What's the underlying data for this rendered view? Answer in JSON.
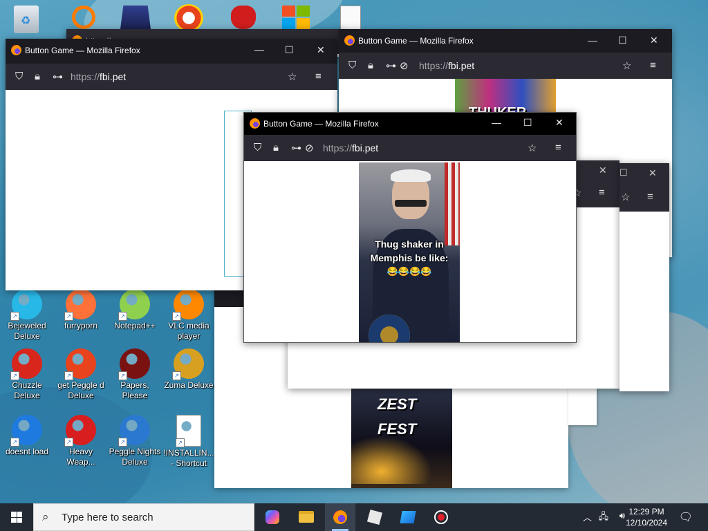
{
  "desktop": {
    "icons": [
      {
        "label": "Bejeweled Deluxe",
        "icon": "bejeweled-icon",
        "color": "#28b8e8"
      },
      {
        "label": "furryporn",
        "icon": "firefox-icon",
        "color": "#ff7139"
      },
      {
        "label": "Notepad++",
        "icon": "notepadpp-icon",
        "color": "#8fd14f"
      },
      {
        "label": "VLC media player",
        "icon": "vlc-icon",
        "color": "#ff8800"
      },
      {
        "label": "Chuzzle Deluxe",
        "icon": "chuzzle-icon",
        "color": "#d9261c"
      },
      {
        "label": "get Peggle d Deluxe",
        "icon": "peggle-icon",
        "color": "#e8431d"
      },
      {
        "label": "Papers, Please",
        "icon": "papers-please-icon",
        "color": "#7a1212"
      },
      {
        "label": "Zuma Deluxe",
        "icon": "zuma-icon",
        "color": "#d8a020"
      },
      {
        "label": "doesnt load",
        "icon": "thunderbird-icon",
        "color": "#1f7ae0"
      },
      {
        "label": "Heavy Weap...",
        "icon": "radiation-icon",
        "color": "#d81e1e"
      },
      {
        "label": "Peggle Nights Deluxe",
        "icon": "peggle-nights-icon",
        "color": "#2a78d0"
      },
      {
        "label": "!INSTALLIN... - Shortcut",
        "icon": "text-file-icon",
        "color": "#ffffff"
      }
    ],
    "top_icons": [
      "recycle-bin-icon",
      "search-app-icon",
      "malwarebytes-icon",
      "peggle-icon",
      "angry-birds-icon",
      "windows-logo-icon",
      "text-file-icon"
    ]
  },
  "browser": {
    "title": "Button Game — Mozilla Firefox",
    "url_scheme": "https://",
    "url_host": "fbi.pet",
    "back_tab_url": "https://www"
  },
  "meme": {
    "caption_line1": "Thug shaker in",
    "caption_line2": "Memphis be like:",
    "emojis": "😂😂😂😂"
  },
  "background_images": {
    "top_right_text": "THUKER",
    "bottom_text_1": "ZEST",
    "bottom_text_2": "FEST"
  },
  "taskbar": {
    "search_placeholder": "Type here to search",
    "time": "12:29 PM",
    "date": "12/10/2024",
    "apps": [
      "copilot-icon",
      "file-explorer-icon",
      "firefox-icon",
      "roblox-icon",
      "roblox-studio-icon",
      "record-icon"
    ]
  },
  "colors": {
    "titlebar": "#1c1b22",
    "navbar": "#2b2a33",
    "taskbar": "#232a33"
  }
}
